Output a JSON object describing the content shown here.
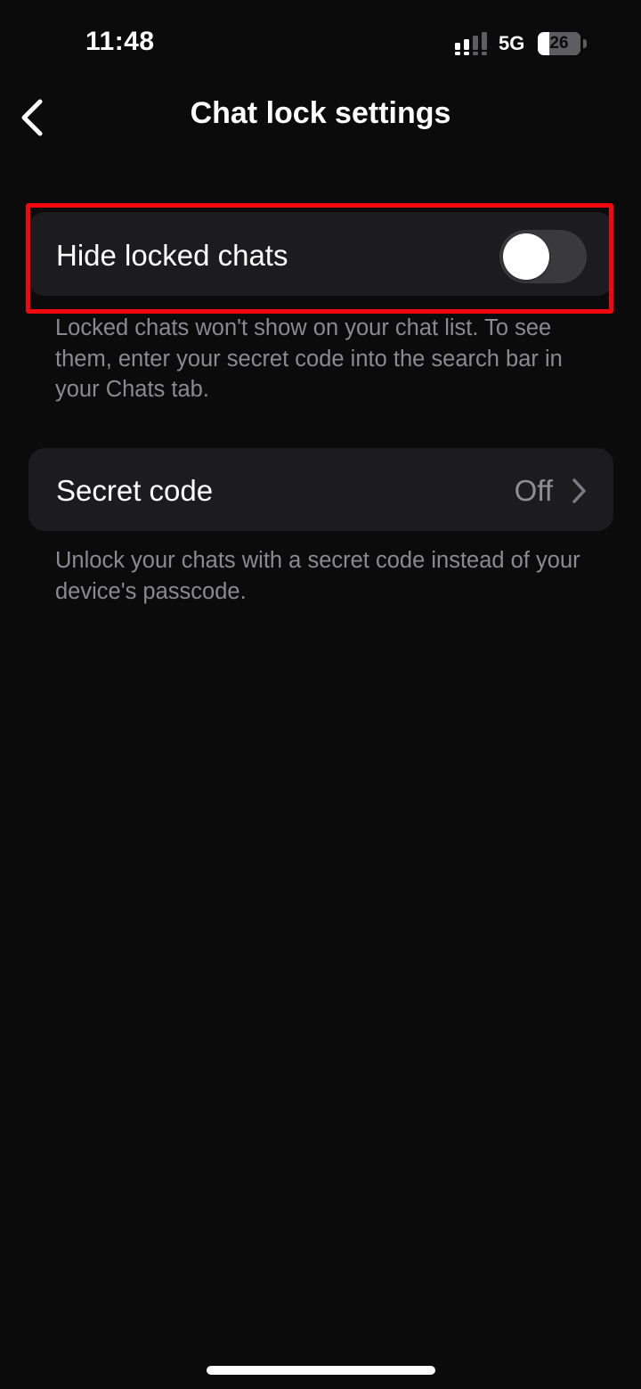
{
  "status_bar": {
    "time": "11:48",
    "network": "5G",
    "battery_level": "26",
    "signal_icon": "signal-bars-icon",
    "battery_icon": "battery-icon"
  },
  "header": {
    "title": "Chat lock settings",
    "back_icon": "chevron-left-icon"
  },
  "settings": {
    "hide_locked_chats": {
      "label": "Hide locked chats",
      "enabled": false,
      "footnote": "Locked chats won't show on your chat list. To see them, enter your secret code into the search bar in your Chats tab."
    },
    "secret_code": {
      "label": "Secret code",
      "value": "Off",
      "chevron_icon": "chevron-right-icon",
      "footnote": "Unlock your chats with a secret code instead of your device's passcode."
    }
  },
  "colors": {
    "background": "#0b0b0c",
    "card": "#1c1c1e",
    "secondary_text": "#8a8a8f",
    "highlight": "#f2070f",
    "toggle_off": "#3a3a3c"
  }
}
